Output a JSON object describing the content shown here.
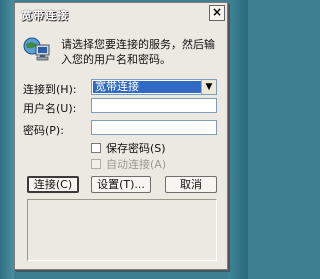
{
  "window": {
    "title": "宽带连接",
    "close_glyph": "×"
  },
  "intro_text": "请选择您要连接的服务，然后输入您的用户名和密码。",
  "form": {
    "connect_to_label": "连接到(H):",
    "connect_to_value": "宽带连接",
    "username_label": "用户名(U):",
    "username_value": "",
    "password_label": "密码(P):",
    "password_value": "",
    "save_password_label": "保存密码(S)",
    "auto_connect_label": "自动连接(A)"
  },
  "buttons": {
    "connect": "连接(C)",
    "settings": "设置(T)...",
    "cancel": "取消"
  },
  "colors": {
    "selection": "#316ac5",
    "dialog_face": "#ebe9e1",
    "desktop": "#3f7f92"
  },
  "icons": {
    "header": "network-connection-icon",
    "close": "close-icon",
    "dropdown": "chevron-down-icon"
  }
}
